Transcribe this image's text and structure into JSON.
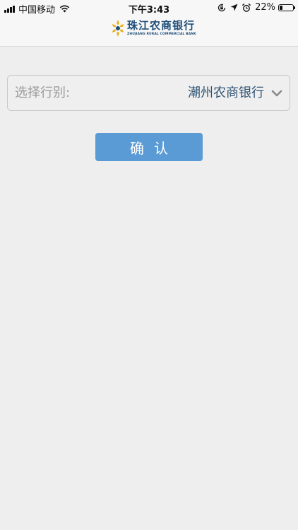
{
  "status_bar": {
    "carrier": "中国移动",
    "time": "下午3:43",
    "battery_percent": "22%",
    "battery_level": 0.22,
    "icons": [
      "signal-icon",
      "wifi-icon",
      "rotation-lock-icon",
      "location-icon",
      "alarm-icon",
      "battery-icon"
    ]
  },
  "header": {
    "logo_cn": "珠江农商银行",
    "logo_en": "ZHUJIANG RURAL COMMERCIAL BANK",
    "logo_colors": {
      "gold": "#e8b21c",
      "navy": "#1f4e79"
    }
  },
  "form": {
    "select_label": "选择行别:",
    "select_value": "潮州农商银行",
    "chevron_icon": "chevron-down-icon",
    "confirm_label": "确认"
  },
  "colors": {
    "background": "#eeeeee",
    "button": "#5b9bd5",
    "value_text": "#2f5473",
    "label_text": "#9a9a9a"
  }
}
